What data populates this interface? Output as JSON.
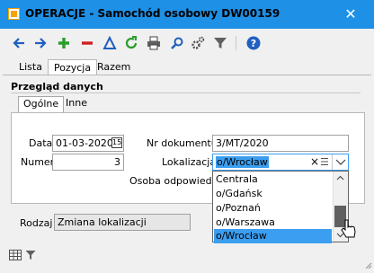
{
  "window": {
    "title": "OPERACJE - Samochód osobowy DW00159",
    "close_glyph": "✕"
  },
  "colors": {
    "titlebar": "#1e90e6",
    "selection": "#3b9ef0",
    "icon_blue": "#1f5fbf",
    "icon_green": "#2a9d2a",
    "icon_red": "#d02020"
  },
  "toolbar": {
    "icons": [
      "arrow-left-icon",
      "arrow-right-icon",
      "plus-icon",
      "minus-icon",
      "triangle-icon",
      "refresh-icon",
      "print-icon",
      "search-icon",
      "settings-icon",
      "filter-icon",
      "help-icon"
    ]
  },
  "tabs": [
    "Lista",
    "Pozycja",
    "Razem"
  ],
  "section": {
    "title": "Przegląd danych",
    "subtabs": [
      "Ogólne",
      "Inne"
    ]
  },
  "form": {
    "data_label": "Data",
    "data_value": "01-03-2020",
    "calendar_glyph": "15",
    "numer_label": "Numer",
    "numer_value": "3",
    "nr_dokumentu_label": "Nr dokumentu",
    "nr_dokumentu_value": "3/MT/2020",
    "lokalizacja_label": "Lokalizacja",
    "lokalizacja_value": "o/Wrocław",
    "lokalizacja_clear": "×",
    "lokalizacja_menu": "☰",
    "osoba_label": "Osoba odpowiedz.",
    "rodzaj_label": "Rodzaj",
    "rodzaj_value": "Zmiana lokalizacji"
  },
  "dropdown": {
    "options": [
      "Centrala",
      "o/Gdańsk",
      "o/Poznań",
      "o/Warszawa",
      "o/Wrocław"
    ],
    "selected_index": 4
  }
}
